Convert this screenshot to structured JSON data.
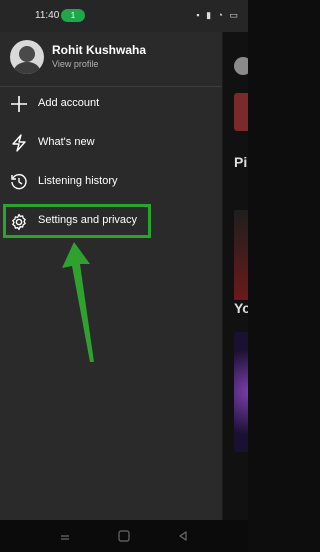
{
  "status_bar": {
    "time": "11:40",
    "badge": "1",
    "icons": [
      "notification-icon",
      "signal-icon",
      "wifi-icon",
      "battery-icon"
    ]
  },
  "profile": {
    "name": "Rohit Kushwaha",
    "link": "View profile"
  },
  "menu": {
    "items": [
      {
        "label": "Add account",
        "icon": "plus-icon"
      },
      {
        "label": "What's new",
        "icon": "lightning-icon"
      },
      {
        "label": "Listening history",
        "icon": "history-icon"
      },
      {
        "label": "Settings and privacy",
        "icon": "gear-icon",
        "highlighted": true
      }
    ]
  },
  "background_app": {
    "heading_1": "Pi",
    "heading_2": "Yo"
  },
  "colors": {
    "drawer_bg": "#2a2a2a",
    "highlight": "#27a52c",
    "arrow": "#2fa12f"
  }
}
